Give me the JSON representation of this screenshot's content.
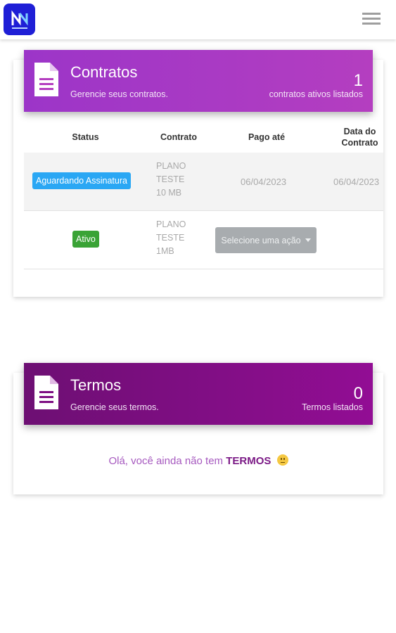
{
  "topbar": {
    "logo_icon": "brand-logo-icon",
    "menu_icon": "hamburger-menu-icon"
  },
  "contratos": {
    "title": "Contratos",
    "subtitle": "Gerencie seus contratos.",
    "count": "1",
    "count_label": "contratos ativos listados",
    "icon": "document-icon",
    "gradient": [
      "#9c35c8",
      "#b43ec0"
    ],
    "table": {
      "headers": {
        "status": "Status",
        "contrato": "Contrato",
        "pago": "Pago até",
        "data_l1": "Data do",
        "data_l2": "Contrato"
      },
      "rows": [
        {
          "status": "Aguardando Assinatura",
          "status_color": "#2aa7f4",
          "plan": [
            "PLANO",
            "TESTE",
            "10 MB"
          ],
          "pago": "06/04/2023",
          "data": "06/04/2023"
        },
        {
          "status": "Ativo",
          "status_color": "#3aa336",
          "plan": [
            "PLANO",
            "TESTE",
            "1MB"
          ],
          "action": "Selecione uma ação"
        }
      ]
    }
  },
  "termos": {
    "title": "Termos",
    "subtitle": "Gerencie seus termos.",
    "count": "0",
    "count_label": "Termos listados",
    "icon": "document-icon",
    "gradient": [
      "#6d0f73",
      "#920d94"
    ],
    "empty_prefix": "Olá, você ainda não tem",
    "empty_bold": "TERMOS",
    "empty_icon": "slightly-frowning-face-icon"
  }
}
